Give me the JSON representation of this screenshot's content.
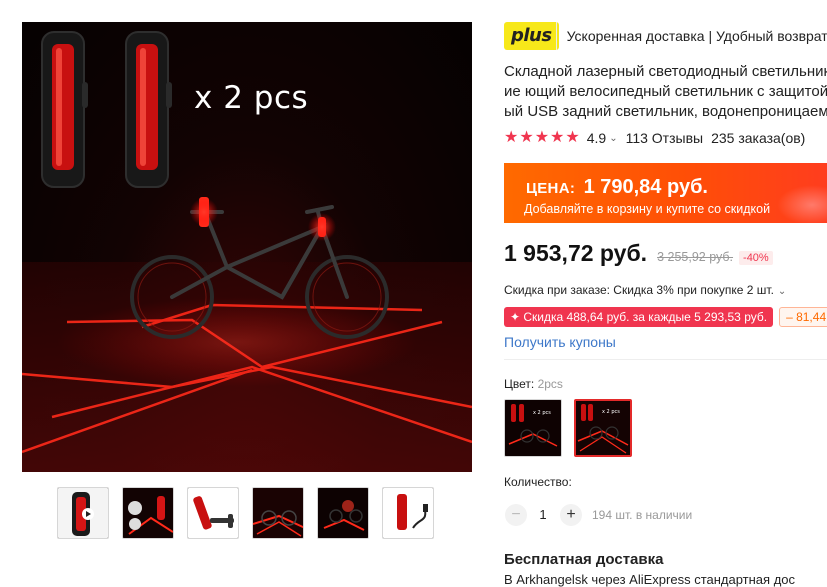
{
  "gallery": {
    "caption": "x 2 pcs",
    "thumb_count": 6
  },
  "plus": {
    "badge": "plus",
    "text": "Ускоренная доставка | Удобный возврат"
  },
  "product": {
    "title_lines": [
      "Складной лазерный светодиодный светильник",
      "ие ющий велосипедный светильник с защитой",
      "ый USB задний светильник, водонепроницаема"
    ],
    "rating": "4.9",
    "reviews": "113 Отзывы",
    "orders": "235 заказа(ов)",
    "rating_stars": 5
  },
  "promo": {
    "label": "ЦЕНА:",
    "price": "1 790,84 руб.",
    "subtitle": "Добавляйте в корзину и купите со скидкой"
  },
  "price": {
    "current": "1 953,72 руб.",
    "old": "3 255,92 руб.",
    "discount": "-40%"
  },
  "bulk": {
    "text": "Скидка при заказе: Скидка 3% при покупке 2 шт."
  },
  "coupons": {
    "red": "✦ Скидка 488,64 руб. за каждые 5 293,53 руб.",
    "orange": "– 81,44",
    "link": "Получить купоны"
  },
  "color": {
    "label": "Цвет:",
    "value": "2pcs",
    "swatch_caption": "x 2 pcs"
  },
  "quantity": {
    "label": "Количество:",
    "minus": "−",
    "value": "1",
    "plus": "+",
    "stock": "194 шт. в наличии"
  },
  "shipping": {
    "title": "Бесплатная доставка",
    "text": "В Arkhangelsk через AliExpress стандартная дос"
  },
  "colors": {
    "accent_red": "#f0354f",
    "promo_orange": "#ff5a00",
    "plus_yellow": "#f7e81a",
    "link_blue": "#3e78c9"
  }
}
